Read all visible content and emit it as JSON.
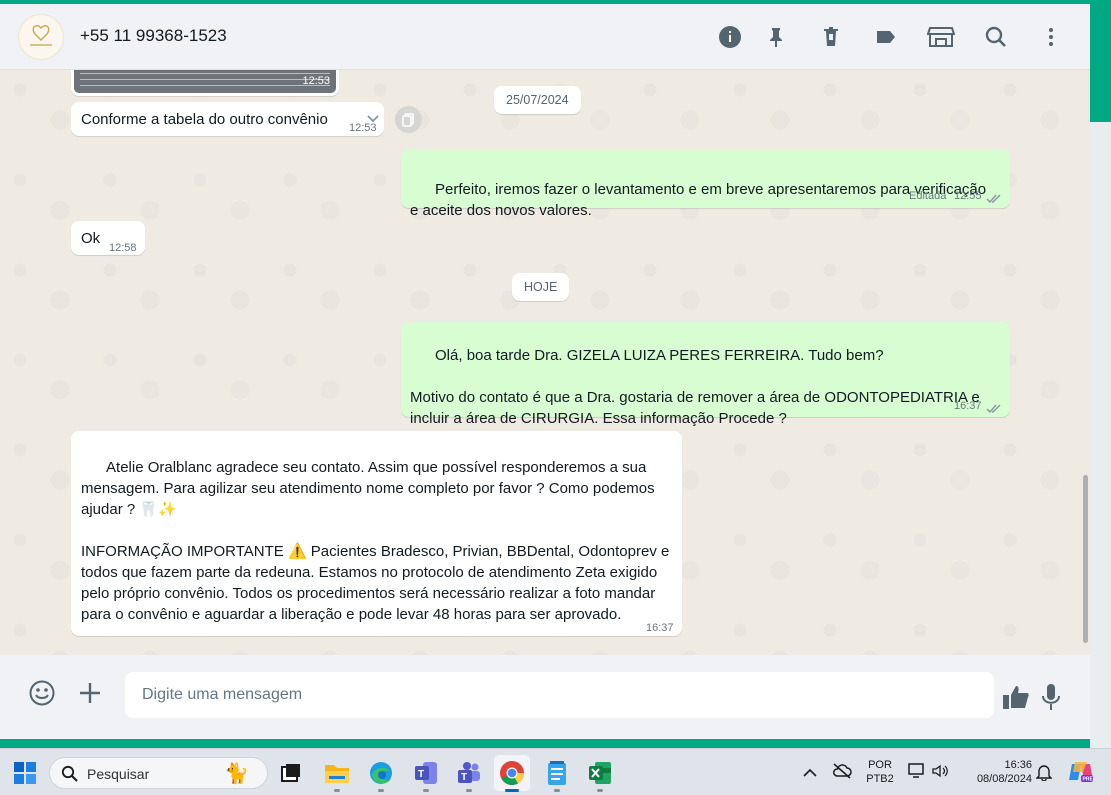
{
  "header": {
    "contact": "+55 11 99368-1523",
    "avatar_logo": "Ateliê Oralblanc",
    "icons": [
      "info-icon",
      "pin-icon",
      "delete-icon",
      "label-icon",
      "catalog-icon",
      "search-icon",
      "menu-icon"
    ]
  },
  "messages": [
    {
      "id": "m0",
      "dir": "in",
      "text": "",
      "time": "12:53",
      "kind": "image-thumbnail"
    },
    {
      "id": "m1",
      "dir": "in",
      "text": "Conforme a tabela do outro convênio",
      "time": "12:53"
    },
    {
      "id": "d1",
      "kind": "date",
      "text": "25/07/2024"
    },
    {
      "id": "m2",
      "dir": "out",
      "text": "Perfeito, iremos fazer o levantamento e em breve apresentaremos para verificação e aceite dos novos valores.",
      "time": "12:55",
      "edited_label": "Editada",
      "status": "read"
    },
    {
      "id": "m3",
      "dir": "in",
      "text": "Ok",
      "time": "12:58"
    },
    {
      "id": "d2",
      "kind": "date",
      "text": "HOJE"
    },
    {
      "id": "m4",
      "dir": "out",
      "text": "Olá, boa tarde Dra. GIZELA LUIZA PERES FERREIRA. Tudo bem?\n\nMotivo do contato é que a Dra. gostaria de remover a área de ODONTOPEDIATRIA e incluir a área de CIRURGIA. Essa informação Procede ?",
      "time": "16:37",
      "status": "read"
    },
    {
      "id": "m5",
      "dir": "in",
      "text": "Atelie Oralblanc agradece seu contato. Assim que possível responderemos a sua mensagem. Para agilizar seu atendimento nome completo por favor ? Como podemos ajudar ? 🦷✨\n\nINFORMAÇÃO IMPORTANTE ⚠️ Pacientes Bradesco, Privian, BBDental, Odontoprev e todos que fazem parte da redeuna. Estamos no protocolo de atendimento Zeta exigido pelo próprio convênio. Todos os procedimentos será necessário realizar a foto mandar para o convênio e aguardar a liberação e pode levar 48 horas para ser aprovado.",
      "time": "16:37"
    }
  ],
  "composer": {
    "placeholder": "Digite uma mensagem",
    "icons": [
      "emoji-icon",
      "attach-icon",
      "like-icon",
      "mic-icon"
    ]
  },
  "taskbar": {
    "search_placeholder": "Pesquisar",
    "apps": [
      "start",
      "task-view",
      "file-explorer",
      "edge",
      "teams-classroom",
      "teams",
      "chrome",
      "notepad",
      "excel"
    ],
    "active_app": "chrome",
    "lang_top": "POR",
    "lang_bottom": "PTB2",
    "time": "16:36",
    "date": "08/08/2024"
  },
  "colors": {
    "accent": "#00a884",
    "outgoing": "#d9fdd3",
    "incoming": "#ffffff",
    "read_tick": "#8696a0"
  }
}
